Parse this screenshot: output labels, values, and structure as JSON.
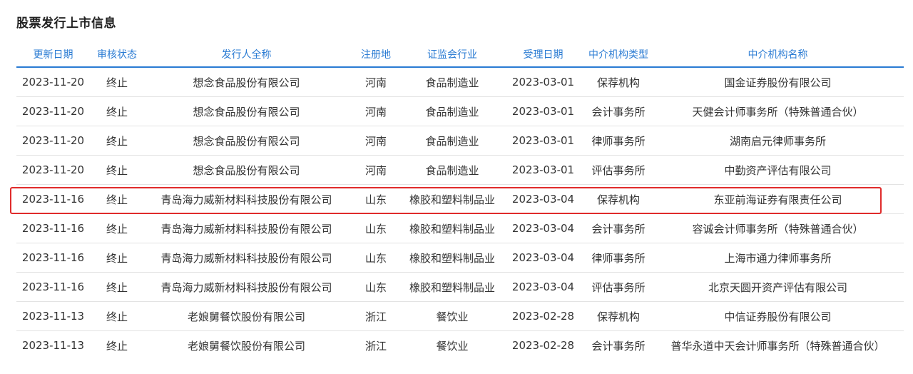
{
  "title": "股票发行上市信息",
  "columns": [
    "更新日期",
    "审核状态",
    "发行人全称",
    "注册地",
    "证监会行业",
    "受理日期",
    "中介机构类型",
    "中介机构名称"
  ],
  "rows": [
    [
      "2023-11-20",
      "终止",
      "想念食品股份有限公司",
      "河南",
      "食品制造业",
      "2023-03-01",
      "保荐机构",
      "国金证券股份有限公司"
    ],
    [
      "2023-11-20",
      "终止",
      "想念食品股份有限公司",
      "河南",
      "食品制造业",
      "2023-03-01",
      "会计事务所",
      "天健会计师事务所（特殊普通合伙）"
    ],
    [
      "2023-11-20",
      "终止",
      "想念食品股份有限公司",
      "河南",
      "食品制造业",
      "2023-03-01",
      "律师事务所",
      "湖南启元律师事务所"
    ],
    [
      "2023-11-20",
      "终止",
      "想念食品股份有限公司",
      "河南",
      "食品制造业",
      "2023-03-01",
      "评估事务所",
      "中勤资产评估有限公司"
    ],
    [
      "2023-11-16",
      "终止",
      "青岛海力威新材料科技股份有限公司",
      "山东",
      "橡胶和塑料制品业",
      "2023-03-04",
      "保荐机构",
      "东亚前海证券有限责任公司"
    ],
    [
      "2023-11-16",
      "终止",
      "青岛海力威新材料科技股份有限公司",
      "山东",
      "橡胶和塑料制品业",
      "2023-03-04",
      "会计事务所",
      "容诚会计师事务所（特殊普通合伙）"
    ],
    [
      "2023-11-16",
      "终止",
      "青岛海力威新材料科技股份有限公司",
      "山东",
      "橡胶和塑料制品业",
      "2023-03-04",
      "律师事务所",
      "上海市通力律师事务所"
    ],
    [
      "2023-11-16",
      "终止",
      "青岛海力威新材料科技股份有限公司",
      "山东",
      "橡胶和塑料制品业",
      "2023-03-04",
      "评估事务所",
      "北京天圆开资产评估有限公司"
    ],
    [
      "2023-11-13",
      "终止",
      "老娘舅餐饮股份有限公司",
      "浙江",
      "餐饮业",
      "2023-02-28",
      "保荐机构",
      "中信证券股份有限公司"
    ],
    [
      "2023-11-13",
      "终止",
      "老娘舅餐饮股份有限公司",
      "浙江",
      "餐饮业",
      "2023-02-28",
      "会计事务所",
      "普华永道中天会计师事务所（特殊普通合伙）"
    ]
  ],
  "highlighted_row": 4,
  "colors": {
    "header_text": "#2a7bd3",
    "header_rule": "#2a7bd3",
    "highlight_border": "#e02b2b",
    "row_divider": "#e3e3e3"
  }
}
